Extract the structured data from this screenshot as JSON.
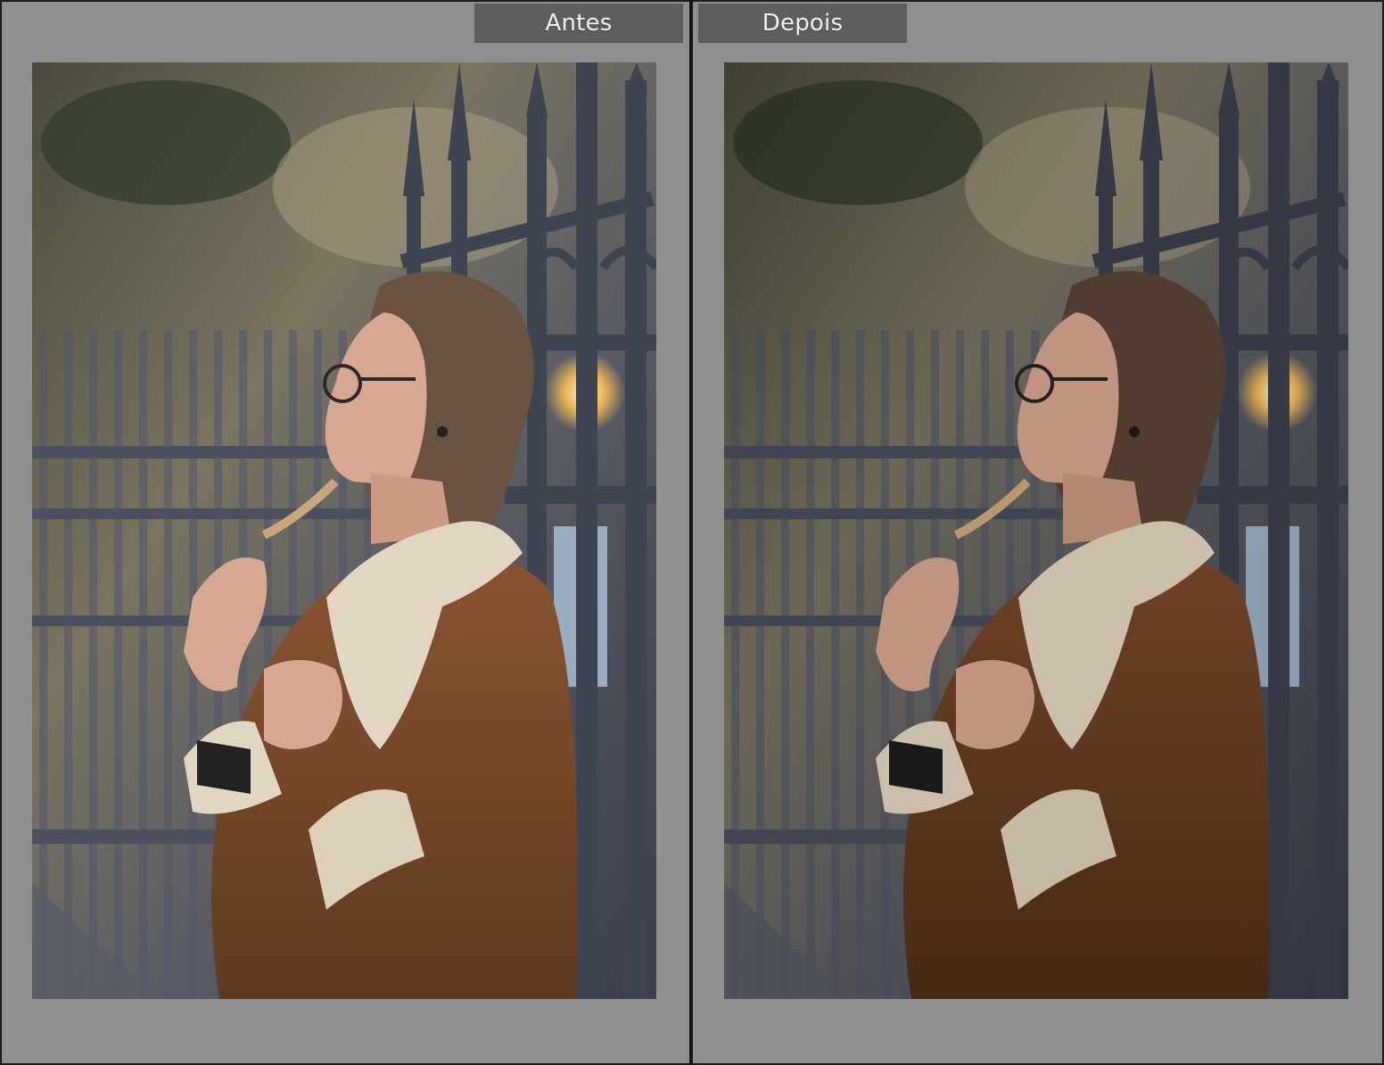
{
  "compare": {
    "before_label": "Antes",
    "after_label": "Depois"
  },
  "photo": {
    "subject": "woman-leaning-on-iron-fence",
    "colors": {
      "background_bokeh": "#6b6752",
      "fence": "#454b58",
      "coat": "#7a4a26",
      "fur": "#e2d6c2",
      "hair": "#6a5240",
      "skin": "#d6a890"
    }
  }
}
